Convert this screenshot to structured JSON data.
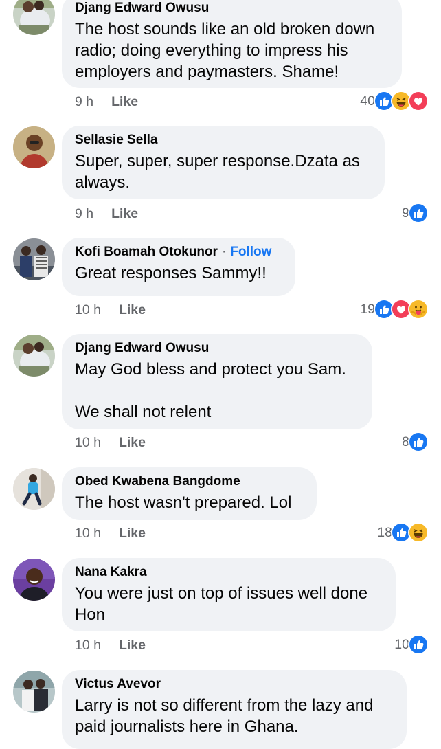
{
  "comments": [
    {
      "author": "Djang Edward Owusu",
      "follow": "",
      "lines": [
        "The host sounds like an old broken down radio; doing everything to impress his employers and paymasters. Shame!"
      ],
      "time": "9 h",
      "like": "Like",
      "reaction_count": "40",
      "reactions": [
        "like-icon",
        "haha-icon",
        "love-icon"
      ]
    },
    {
      "author": "Sellasie Sella",
      "follow": "",
      "lines": [
        "Super, super, super response.Dzata as always."
      ],
      "time": "9 h",
      "like": "Like",
      "reaction_count": "9",
      "reactions": [
        "like-icon"
      ]
    },
    {
      "author": "Kofi Boamah Otokunor",
      "follow": "Follow",
      "lines": [
        "Great responses Sammy!!"
      ],
      "time": "10 h",
      "like": "Like",
      "reaction_count": "19",
      "reactions": [
        "like-icon",
        "love-icon",
        "care-icon"
      ]
    },
    {
      "author": "Djang Edward Owusu",
      "follow": "",
      "lines": [
        "May God bless and protect you Sam.",
        "",
        "We shall not relent"
      ],
      "time": "10 h",
      "like": "Like",
      "reaction_count": "8",
      "reactions": [
        "like-icon"
      ]
    },
    {
      "author": "Obed Kwabena Bangdome",
      "follow": "",
      "lines": [
        "The host wasn't prepared. Lol"
      ],
      "time": "10 h",
      "like": "Like",
      "reaction_count": "18",
      "reactions": [
        "like-icon",
        "haha-icon"
      ]
    },
    {
      "author": "Nana Kakra",
      "follow": "",
      "lines": [
        "You were just on top of issues well done Hon"
      ],
      "time": "10 h",
      "like": "Like",
      "reaction_count": "10",
      "reactions": [
        "like-icon"
      ]
    },
    {
      "author": "Victus Avevor",
      "follow": "",
      "lines": [
        "Larry is not so different from the lazy and paid journalists here in Ghana."
      ],
      "time": "",
      "like": "",
      "reaction_count": "",
      "reactions": []
    }
  ],
  "colors": {
    "like": "#1877f2",
    "love": "#f33e58",
    "haha": "#f7b928",
    "link": "#1877f2"
  }
}
